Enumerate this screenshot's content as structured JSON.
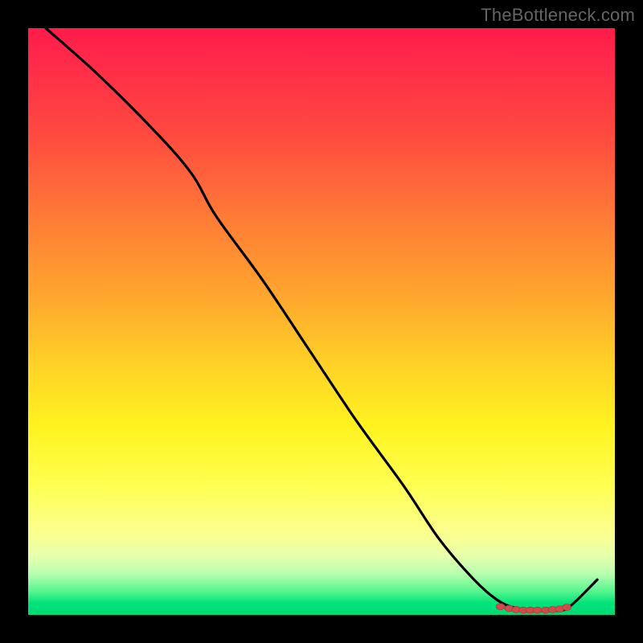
{
  "watermark": "TheBottleneck.com",
  "colors": {
    "frame_bg": "#000000",
    "line": "#000000",
    "point_fill": "#d24a4a",
    "point_stroke": "#a13737",
    "gradient_top": "#ff1b4b",
    "gradient_bottom": "#00d873"
  },
  "chart_data": {
    "type": "line",
    "title": "",
    "xlabel": "",
    "ylabel": "",
    "xlim": [
      0,
      100
    ],
    "ylim": [
      0,
      100
    ],
    "x": [
      3,
      12,
      22,
      28,
      32,
      40,
      48,
      56,
      64,
      70,
      76,
      80,
      83,
      86,
      89,
      92,
      97
    ],
    "y": [
      100,
      92,
      82,
      75,
      68,
      57,
      45,
      33,
      22,
      13,
      6,
      2.5,
      1.2,
      0.8,
      0.8,
      1.2,
      6
    ],
    "emphasized_points_x": [
      80.5,
      82.0,
      83.2,
      84.4,
      85.6,
      86.8,
      88.2,
      89.4,
      90.6,
      91.8
    ],
    "emphasized_points_y": [
      1.4,
      1.1,
      0.9,
      0.8,
      0.8,
      0.8,
      0.8,
      0.9,
      1.0,
      1.3
    ],
    "background": "vertical_red_to_green_gradient"
  }
}
